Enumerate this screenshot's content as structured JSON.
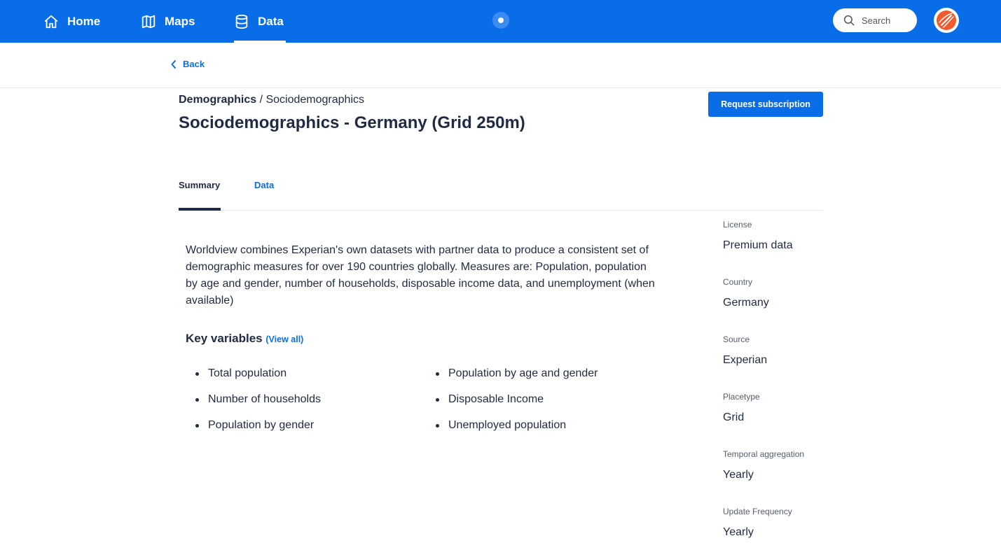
{
  "nav": {
    "home": "Home",
    "maps": "Maps",
    "data": "Data",
    "search_placeholder": "Search"
  },
  "back_label": "Back",
  "breadcrumb": {
    "parent": "Demographics",
    "separator": " / ",
    "current": "Sociodemographics"
  },
  "title": "Sociodemographics - Germany (Grid 250m)",
  "request_button": "Request subscription",
  "tabs": {
    "summary": "Summary",
    "data": "Data"
  },
  "description": "Worldview combines Experian's own datasets with partner data to produce a consistent set of demographic measures for over 190 countries globally. Measures are: Population, population by age and gender, number of households, disposable income data, and unemployment (when available)",
  "key_variables": {
    "heading": "Key variables",
    "view_all": "(View all)",
    "left": [
      "Total population",
      "Number of households",
      "Population by gender"
    ],
    "right": [
      "Population by age and gender",
      "Disposable Income",
      "Unemployed population"
    ]
  },
  "metadata": [
    {
      "label": "License",
      "value": "Premium data"
    },
    {
      "label": "Country",
      "value": "Germany"
    },
    {
      "label": "Source",
      "value": "Experian"
    },
    {
      "label": "Placetype",
      "value": "Grid"
    },
    {
      "label": "Temporal aggregation",
      "value": "Yearly"
    },
    {
      "label": "Update Frequency",
      "value": "Yearly"
    }
  ],
  "colors": {
    "primary": "#0a6de8",
    "text": "#1f2a44"
  }
}
